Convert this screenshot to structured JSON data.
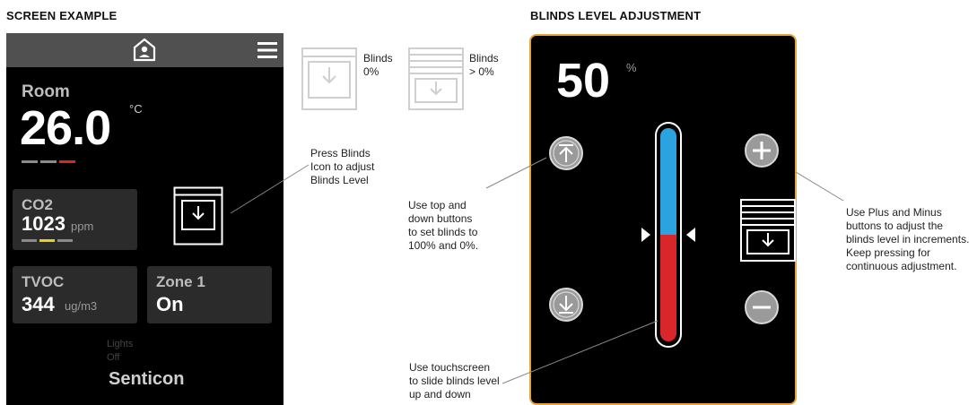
{
  "left_title": "SCREEN EXAMPLE",
  "right_title": "BLINDS LEVEL ADJUSTMENT",
  "screen": {
    "icons": {
      "home": "home-icon",
      "menu": "hamburger-menu-icon"
    },
    "room": {
      "label": "Room",
      "value": "26.0",
      "unit": "°C"
    },
    "co2": {
      "label": "CO2",
      "value": "1023",
      "unit": "ppm"
    },
    "tvoc": {
      "label": "TVOC",
      "value": "344",
      "unit": "ug/m3"
    },
    "zone": {
      "label": "Zone 1",
      "value": "On"
    },
    "lights": {
      "line1": "Lights",
      "line2": "Off"
    },
    "brand": "Senticon"
  },
  "legend": {
    "blinds0": {
      "line1": "Blinds",
      "line2": "0%"
    },
    "blindsGt0": {
      "line1": "Blinds",
      "line2": "> 0%"
    }
  },
  "notes": {
    "press_blinds": [
      "Press Blinds",
      "Icon to adjust",
      "Blinds Level"
    ],
    "top_down": [
      "Use top and",
      "down buttons",
      "to set blinds to",
      "100% and 0%."
    ],
    "touchscreen": [
      "Use touchscreen",
      "to slide blinds level",
      "up and down"
    ],
    "plus_minus": [
      "Use Plus and Minus",
      "buttons to adjust the",
      "blinds level in increments.",
      "Keep pressing for",
      "continuous adjustment."
    ]
  },
  "adjust": {
    "level_value": "50",
    "level_unit": "%",
    "level_fraction": 0.5,
    "colors": {
      "upper": "#2aa3e0",
      "lower": "#d8262a",
      "border": "#e8a33a"
    }
  }
}
